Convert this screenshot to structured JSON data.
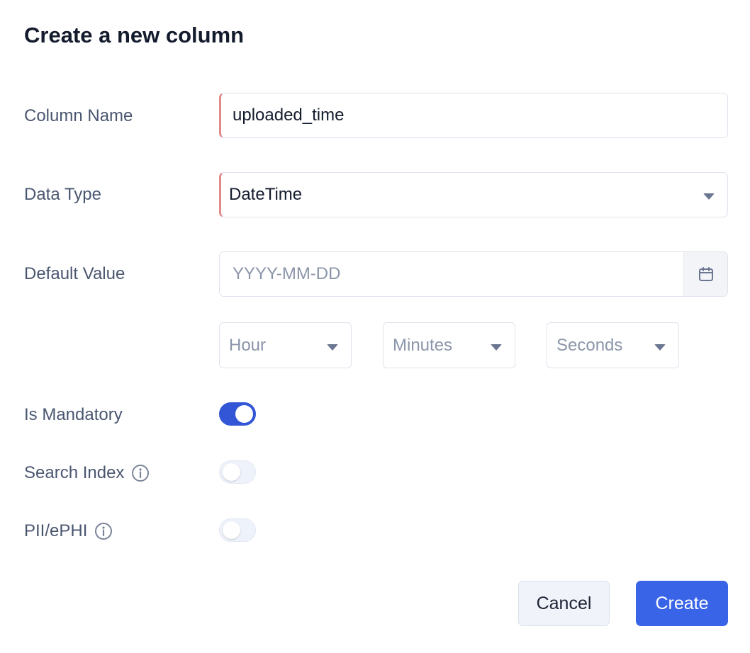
{
  "dialog": {
    "title": "Create a new column"
  },
  "fields": {
    "column_name": {
      "label": "Column Name",
      "value": "uploaded_time"
    },
    "data_type": {
      "label": "Data Type",
      "value": "DateTime"
    },
    "default_value": {
      "label": "Default Value",
      "date_placeholder": "YYYY-MM-DD",
      "hour_placeholder": "Hour",
      "minutes_placeholder": "Minutes",
      "seconds_placeholder": "Seconds"
    },
    "is_mandatory": {
      "label": "Is Mandatory",
      "enabled": true
    },
    "search_index": {
      "label": "Search Index",
      "enabled": false
    },
    "pii_ephi": {
      "label": "PII/ePHI",
      "enabled": false
    }
  },
  "actions": {
    "cancel_label": "Cancel",
    "create_label": "Create"
  },
  "colors": {
    "primary": "#3a64e8",
    "toggle_on": "#3356d6",
    "required_marker": "#e08a8a"
  },
  "icons": {
    "calendar": "calendar-icon",
    "info": "info-icon",
    "dropdown": "chevron-down-icon"
  }
}
